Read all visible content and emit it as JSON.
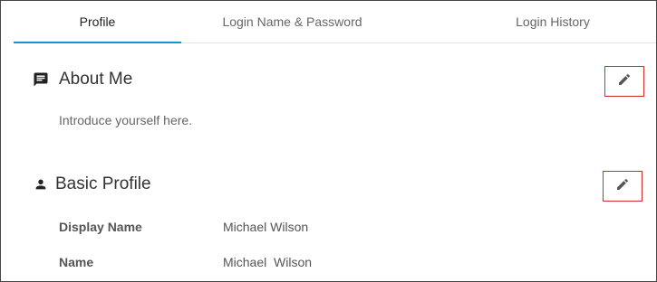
{
  "tabs": [
    {
      "label": "Profile",
      "active": true
    },
    {
      "label": "Login Name & Password",
      "active": false
    },
    {
      "label": "Login History",
      "active": false
    }
  ],
  "about_me": {
    "title": "About Me",
    "icon": "chat-bubble-icon",
    "placeholder_text": "Introduce yourself here.",
    "edit_icon": "pencil-icon"
  },
  "basic_profile": {
    "title": "Basic Profile",
    "icon": "person-icon",
    "edit_icon": "pencil-icon",
    "rows": [
      {
        "label": "Display Name",
        "value": "Michael Wilson"
      },
      {
        "label": "Name",
        "value": "Michael  Wilson"
      }
    ]
  },
  "colors": {
    "accent": "#1b8fd6",
    "highlight_border": "#d42a2a"
  }
}
